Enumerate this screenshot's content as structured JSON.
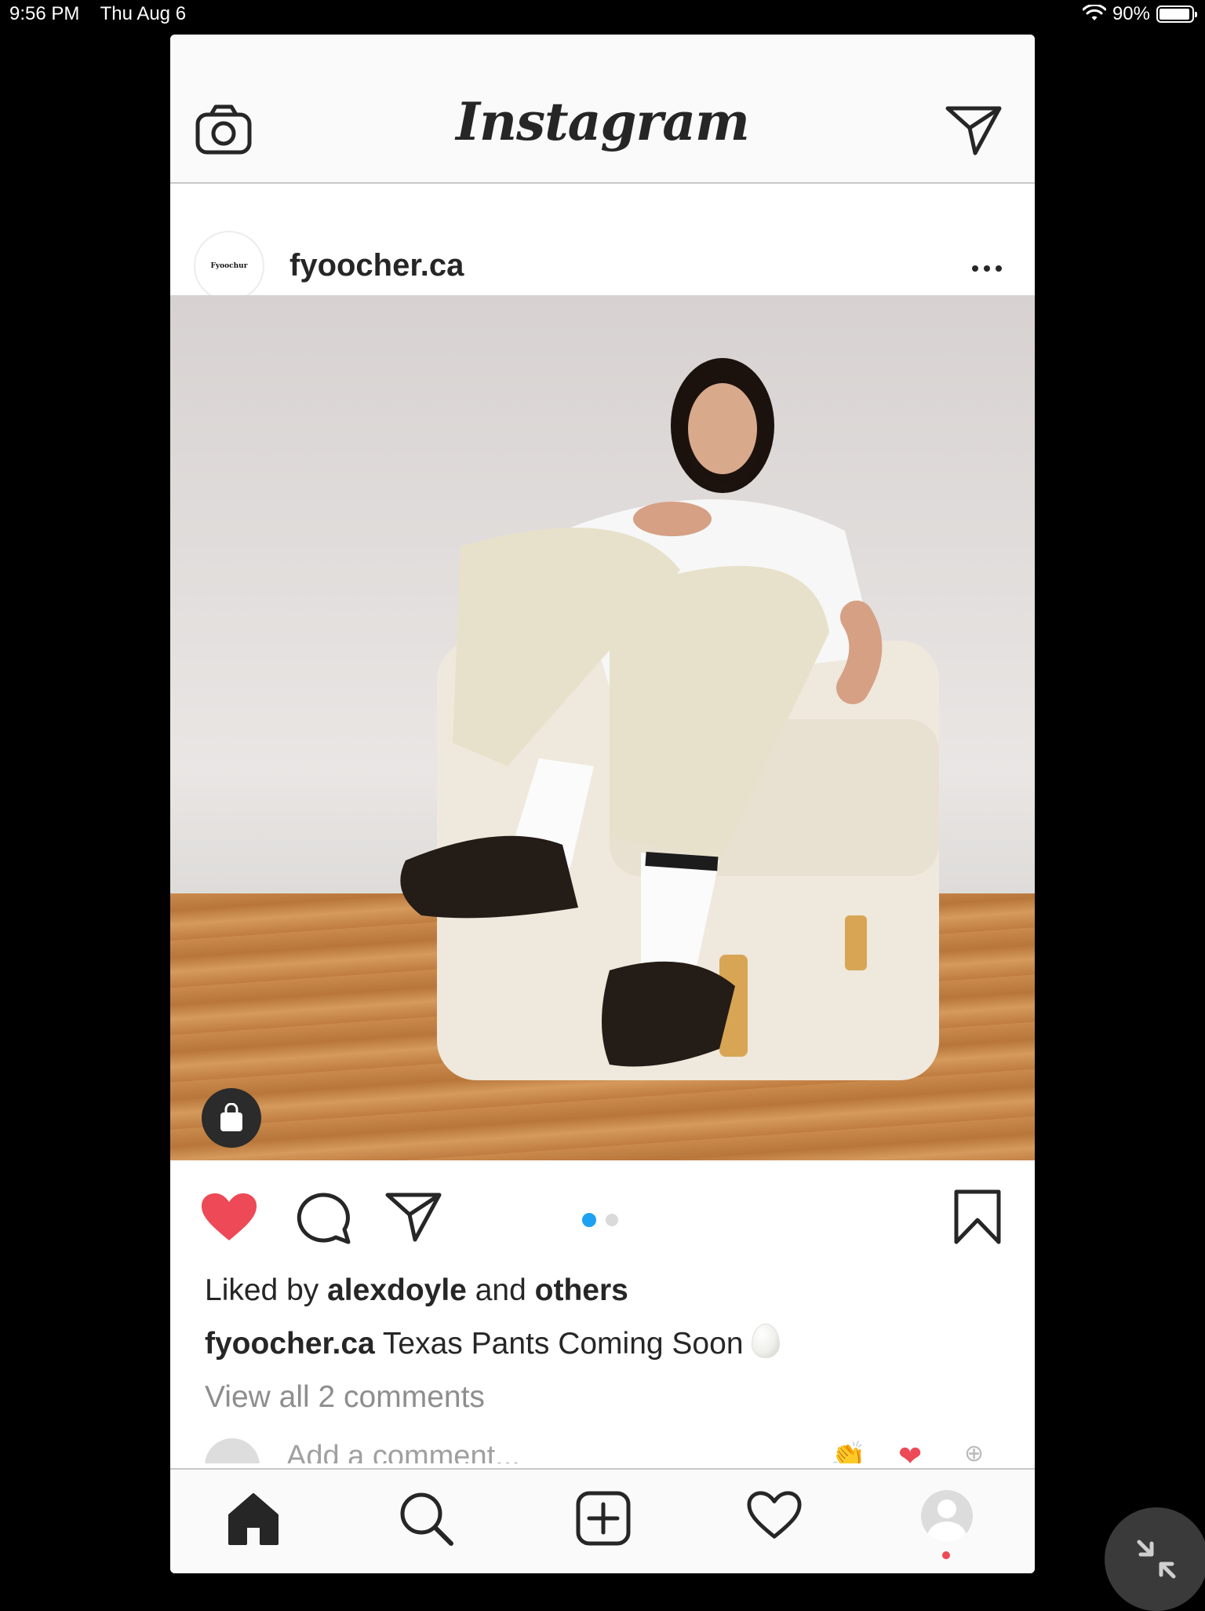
{
  "status_bar": {
    "time": "9:56 PM",
    "date": "Thu Aug 6",
    "battery": "90%"
  },
  "header": {
    "brand": "Instagram",
    "camera_icon": "camera-icon",
    "direct_icon": "direct-message-icon"
  },
  "post": {
    "avatar_label": "Fyoochur",
    "username": "fyoocher.ca",
    "more_icon": "more-options-icon",
    "shop_icon": "shopping-bag-icon",
    "carousel": {
      "current": 1,
      "total": 2
    },
    "liked_prefix": "Liked by",
    "liked_user": "alexdoyle",
    "liked_and": "and",
    "liked_others": "others",
    "caption_user": "fyoocher.ca",
    "caption_text": "Texas Pants Coming Soon",
    "view_comments": "View all 2 comments",
    "add_comment_placeholder": "Add a comment..."
  },
  "colors": {
    "like_red": "#ED4956",
    "carousel_active": "#1DA1F2",
    "muted_text": "#8E8E8E"
  },
  "tabbar": {
    "items": [
      "home-icon",
      "search-icon",
      "new-post-icon",
      "activity-heart-icon",
      "profile-icon"
    ]
  }
}
